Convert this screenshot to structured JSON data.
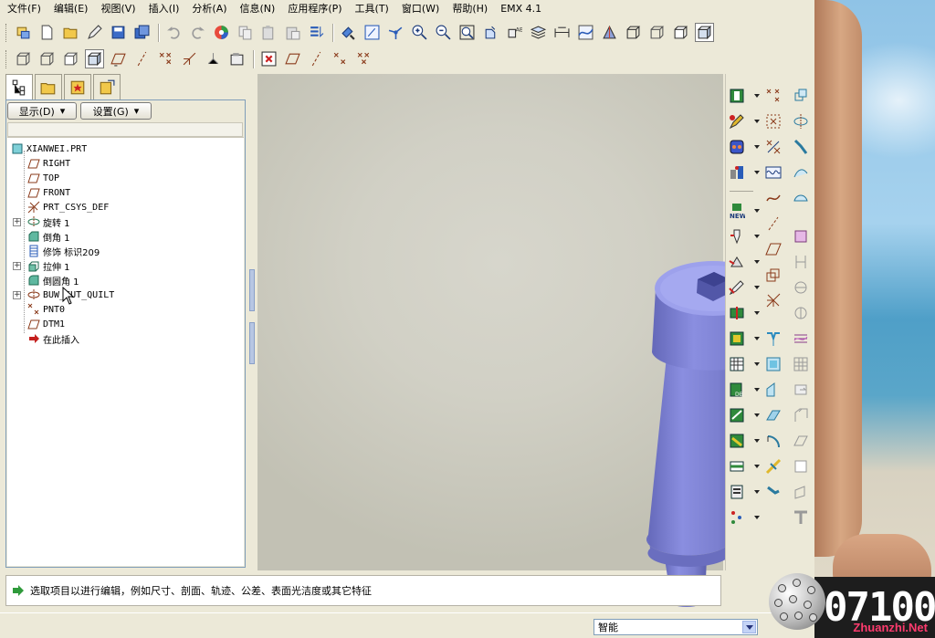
{
  "menu": [
    "文件(F)",
    "编辑(E)",
    "视图(V)",
    "插入(I)",
    "分析(A)",
    "信息(N)",
    "应用程序(P)",
    "工具(T)",
    "窗口(W)",
    "帮助(H)",
    "EMX 4.1"
  ],
  "navigator": {
    "display_label": "显示(D)",
    "settings_label": "设置(G)"
  },
  "tree": [
    {
      "label": "XIANWEI.PRT",
      "icon": "part-icon",
      "level": 0,
      "expandable": false
    },
    {
      "label": "RIGHT",
      "icon": "datum-plane-icon",
      "level": 1,
      "expandable": false
    },
    {
      "label": "TOP",
      "icon": "datum-plane-icon",
      "level": 1,
      "expandable": false
    },
    {
      "label": "FRONT",
      "icon": "datum-plane-icon",
      "level": 1,
      "expandable": false
    },
    {
      "label": "PRT_CSYS_DEF",
      "icon": "coordinate-system-icon",
      "level": 1,
      "expandable": false
    },
    {
      "label": "旋转 1",
      "icon": "revolve-icon",
      "level": 1,
      "expandable": true
    },
    {
      "label": "倒角 1",
      "icon": "chamfer-icon",
      "level": 1,
      "expandable": false
    },
    {
      "label": "修饰 标识209",
      "icon": "cosmetic-thread-icon",
      "level": 1,
      "expandable": false
    },
    {
      "label": "拉伸 1",
      "icon": "extrude-icon",
      "level": 1,
      "expandable": true
    },
    {
      "label": "倒圆角 1",
      "icon": "round-icon",
      "level": 1,
      "expandable": false
    },
    {
      "label": "BUW_CUT_QUILT",
      "icon": "quilt-icon",
      "level": 1,
      "expandable": true
    },
    {
      "label": "PNT0",
      "icon": "datum-point-icon",
      "level": 1,
      "expandable": false
    },
    {
      "label": "DTM1",
      "icon": "datum-plane-icon",
      "level": 1,
      "expandable": false
    },
    {
      "label": "在此插入",
      "icon": "insert-here-arrow-icon",
      "level": 1,
      "expandable": false
    }
  ],
  "status_message": "选取项目以进行编辑，例如尺寸、剖面、轨迹、公差、表面光洁度或其它特征",
  "selection_filter": "智能",
  "watermark": {
    "number": "07100",
    "site": "Zhuanzhi.Net"
  },
  "colors": {
    "model": "#7b7fcf",
    "viewport": "#d2d1c6",
    "accent": "#2a5cb8"
  }
}
